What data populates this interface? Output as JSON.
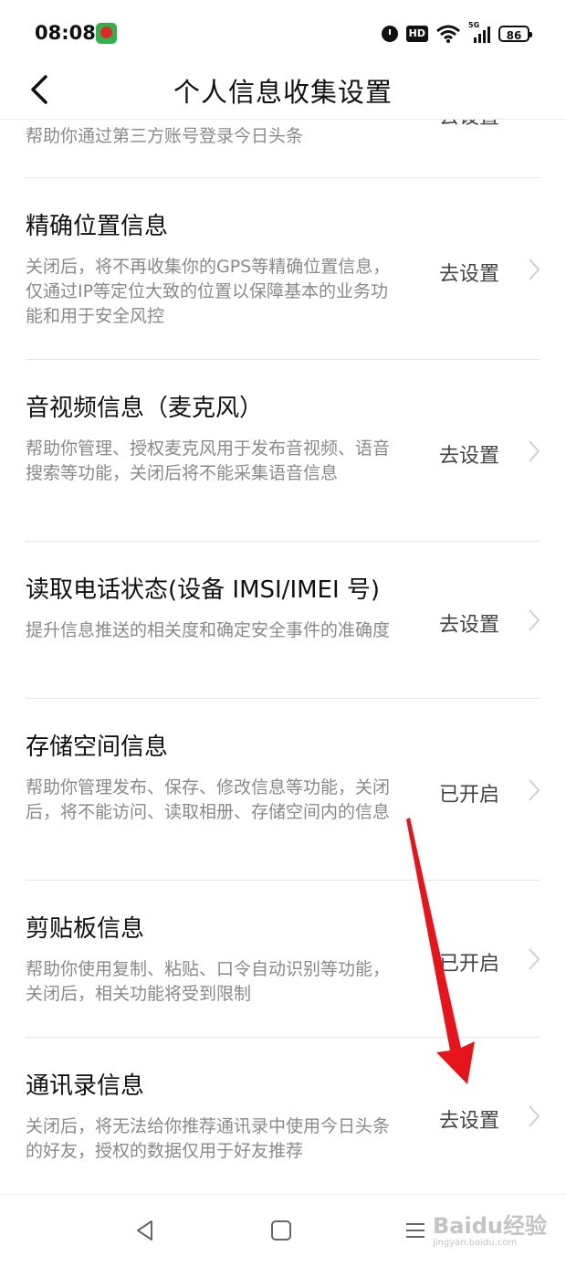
{
  "status_bar": {
    "time": "08:08",
    "hd_label": "HD",
    "network_label": "5G",
    "battery": "86",
    "icons": [
      "app-icon",
      "alarm-icon",
      "hd-icon",
      "wifi-icon",
      "signal-icon",
      "battery-icon"
    ]
  },
  "header": {
    "title": "个人信息收集设置",
    "back_icon": "chevron-left-icon"
  },
  "partial_item": {
    "desc": "帮助你通过第三方账号登录今日头条",
    "action": "去设置"
  },
  "items": [
    {
      "title": "精确位置信息",
      "desc": "关闭后，将不再收集你的GPS等精确位置信息，仅通过IP等定位大致的位置以保障基本的业务功能和用于安全风控",
      "action": "去设置"
    },
    {
      "title": "音视频信息（麦克风）",
      "desc": "帮助你管理、授权麦克风用于发布音视频、语音搜索等功能，关闭后将不能采集语音信息",
      "action": "去设置"
    },
    {
      "title": "读取电话状态(设备 IMSI/IMEI 号)",
      "desc": "提升信息推送的相关度和确定安全事件的准确度",
      "action": "去设置"
    },
    {
      "title": "存储空间信息",
      "desc": "帮助你管理发布、保存、修改信息等功能，关闭后，将不能访问、读取相册、存储空间内的信息",
      "action": "已开启"
    },
    {
      "title": "剪贴板信息",
      "desc": "帮助你使用复制、粘贴、口令自动识别等功能，关闭后，相关功能将受到限制",
      "action": "已开启"
    },
    {
      "title": "通讯录信息",
      "desc": "关闭后，将无法给你推荐通讯录中使用今日头条的好友，授权的数据仅用于好友推荐",
      "action": "去设置"
    }
  ],
  "nav": {
    "icons": [
      "back-triangle-icon",
      "home-square-icon",
      "menu-lines-icon"
    ]
  },
  "watermark": {
    "text": "Baidu经验",
    "sub": "jingyan.baidu.com"
  },
  "colors": {
    "title": "#111111",
    "description": "#8a8a8a",
    "action": "#444444",
    "divider": "#e6e6e6",
    "arrow": "#e8141b"
  }
}
